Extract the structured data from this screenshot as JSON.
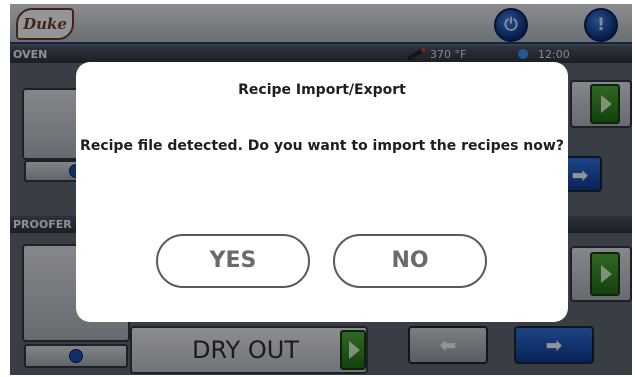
{
  "header": {
    "logo_text": "Duke",
    "power_icon": "power-icon",
    "alert_icon": "alert-icon"
  },
  "oven_section": {
    "label": "OVEN",
    "temperature": "370 °F",
    "time": "12:00"
  },
  "proofer_section": {
    "label": "PROOFER",
    "mode_label": "DRY OUT"
  },
  "dialog": {
    "title": "Recipe Import/Export",
    "message": "Recipe file detected. Do you want to import the recipes now?",
    "yes_label": "YES",
    "no_label": "NO"
  },
  "colors": {
    "brand_blue": "#0d3a8e",
    "go_green": "#2f8a22",
    "logo_brown": "#6d3b2b"
  }
}
